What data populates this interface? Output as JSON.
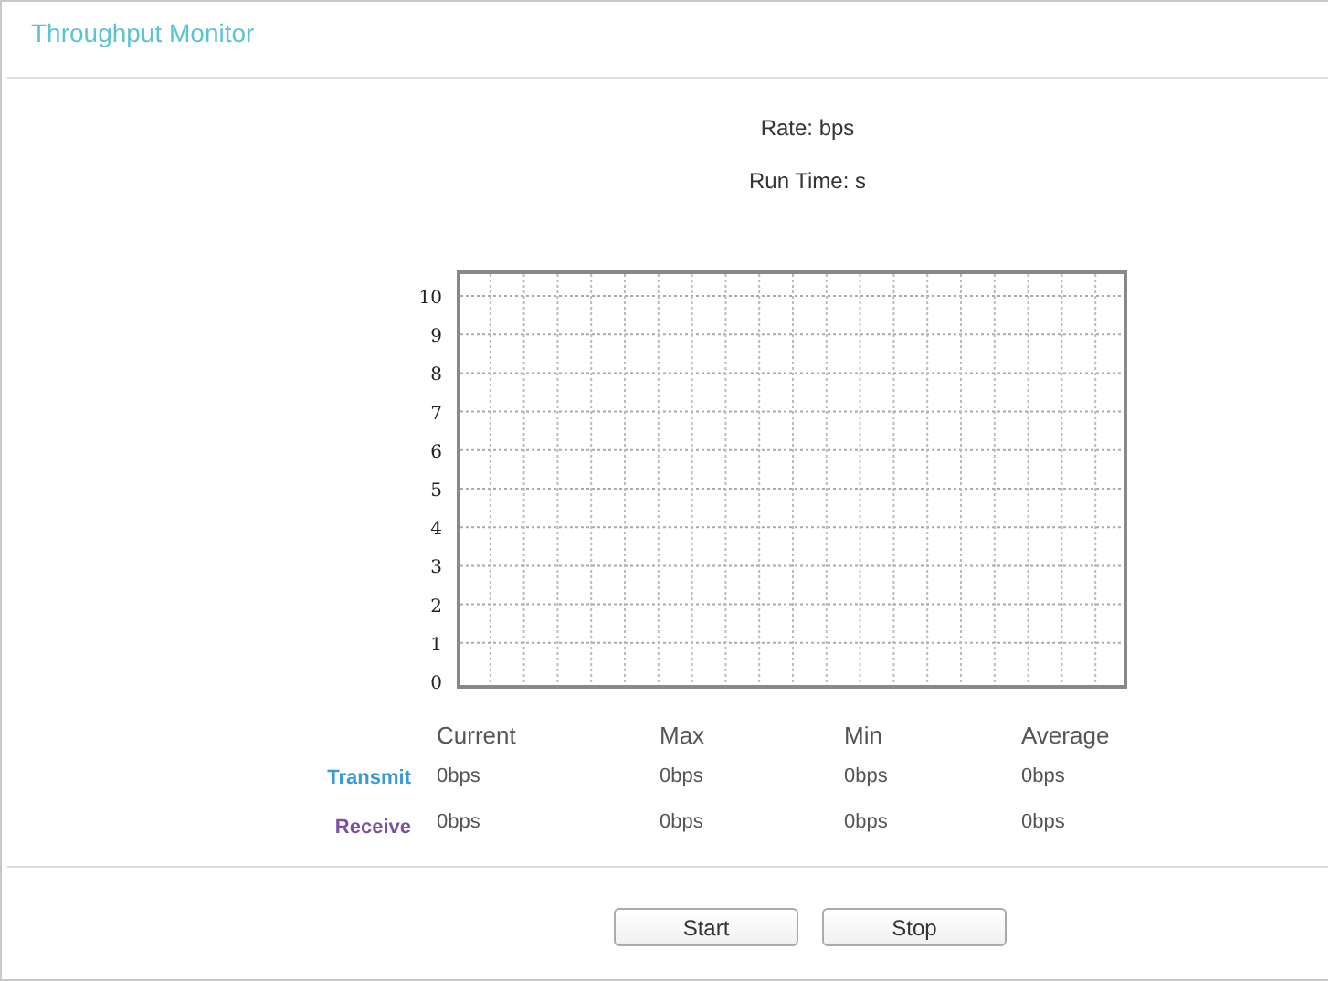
{
  "title": "Throughput Monitor",
  "rate": {
    "label": "Rate:",
    "value": "bps"
  },
  "run_time": {
    "label": "Run Time:",
    "value": "s"
  },
  "graph": {
    "y_labels": [
      "10",
      "9",
      "8",
      "7",
      "6",
      "5",
      "4",
      "3",
      "2",
      "1",
      "0"
    ]
  },
  "stats": {
    "columns": [
      "Current",
      "Max",
      "Min",
      "Average"
    ],
    "rows": [
      {
        "label": "Transmit",
        "color": "#3a9ad9",
        "values": [
          "0bps",
          "0bps",
          "0bps",
          "0bps"
        ]
      },
      {
        "label": "Receive",
        "color": "#7e4fa6",
        "values": [
          "0bps",
          "0bps",
          "0bps",
          "0bps"
        ]
      }
    ]
  },
  "buttons": [
    "Start",
    "Stop"
  ]
}
